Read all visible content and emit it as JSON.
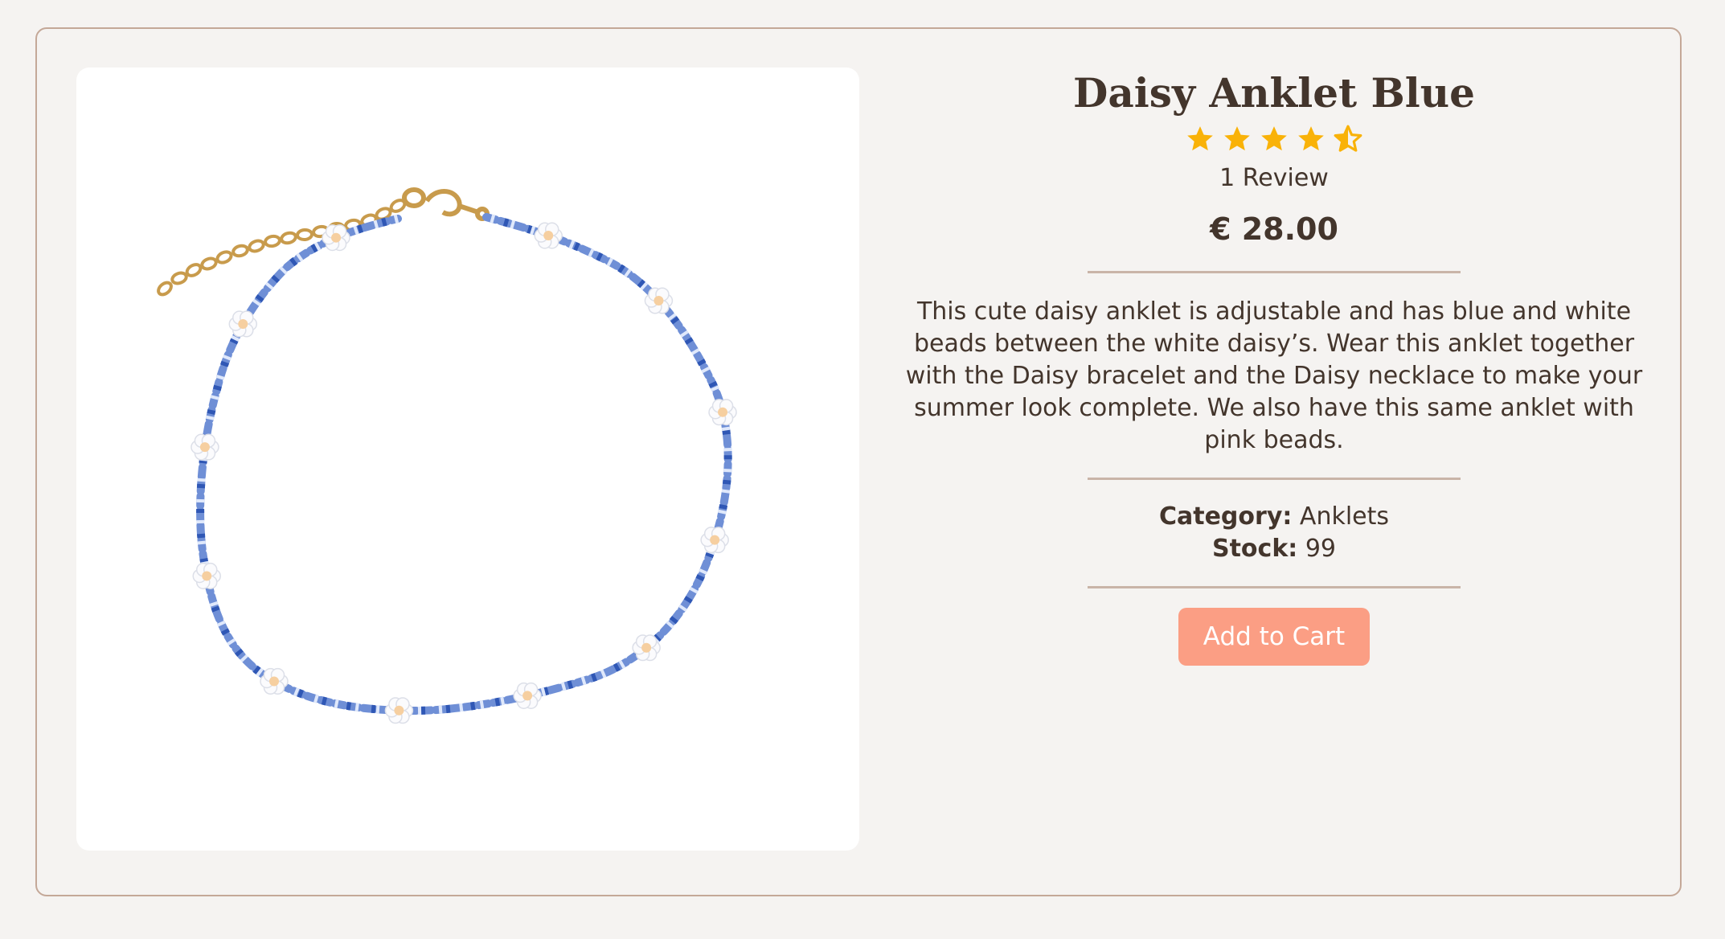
{
  "product": {
    "title": "Daisy Anklet Blue",
    "rating": 4.5,
    "rating_max": 5,
    "review_count_label": "1 Review",
    "price": "€ 28.00",
    "description": "This cute daisy anklet is adjustable and has blue and white beads between the white daisy’s. Wear this anklet together with the Daisy bracelet and the Daisy necklace to make your summer look complete. We also have this same anklet with pink beads.",
    "category_label": "Category:",
    "category_value": "Anklets",
    "stock_label": "Stock:",
    "stock_value": "99",
    "add_to_cart_label": "Add to Cart"
  },
  "colors": {
    "accent": "#fb9e84",
    "star": "#f9b208",
    "border": "#c4a898",
    "text": "#43352c",
    "bead_blue": "#4a74c9",
    "gold": "#c89b4c"
  }
}
